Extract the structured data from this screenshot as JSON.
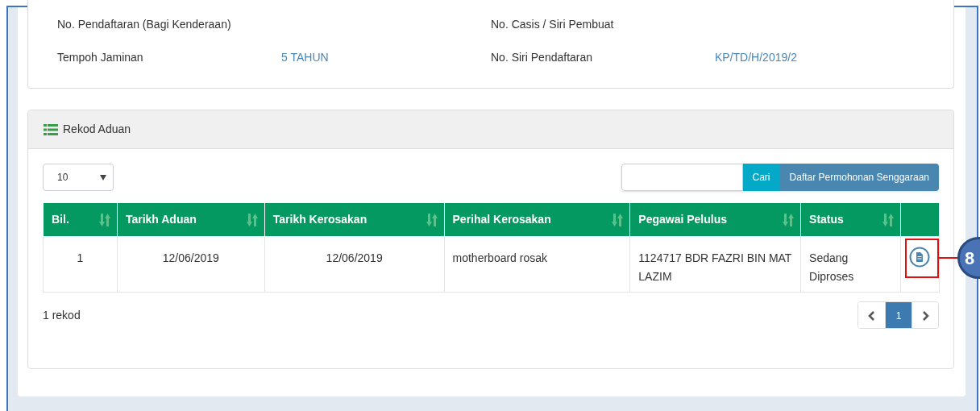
{
  "details": [
    {
      "label": "No. Pendaftaran (Bagi Kenderaan)"
    },
    {
      "label": "No. Casis / Siri Pembuat"
    },
    {
      "label": "Tempoh Jaminan",
      "value": "5 TAHUN"
    },
    {
      "label": "No. Siri Pendaftaran",
      "value": "KP/TD/H/2019/2"
    }
  ],
  "panel": {
    "title": "Rekod Aduan"
  },
  "page_size": "10",
  "search": {
    "button": "Cari",
    "action_button": "Daftar Permohonan Senggaraan"
  },
  "table": {
    "columns": [
      {
        "label": "Bil.",
        "sortable": true
      },
      {
        "label": "Tarikh Aduan",
        "sortable": true
      },
      {
        "label": "Tarikh Kerosakan",
        "sortable": true
      },
      {
        "label": "Perihal Kerosakan",
        "sortable": true
      },
      {
        "label": "Pegawai Pelulus",
        "sortable": true
      },
      {
        "label": "Status",
        "sortable": true
      },
      {
        "sortable": false
      }
    ],
    "rows": [
      {
        "cells": [
          "1",
          "12/06/2019",
          "12/06/2019",
          "motherboard rosak",
          "1124717 BDR FAZRI BIN MAT LAZIM",
          "Sedang Diproses"
        ]
      }
    ]
  },
  "record_count": "1 rekod",
  "pagination": [
    {
      "kind": "prev",
      "selected": false
    },
    {
      "kind": "page",
      "label": "1",
      "selected": true
    },
    {
      "kind": "next",
      "selected": false
    }
  ],
  "callout": {
    "number": "8"
  }
}
